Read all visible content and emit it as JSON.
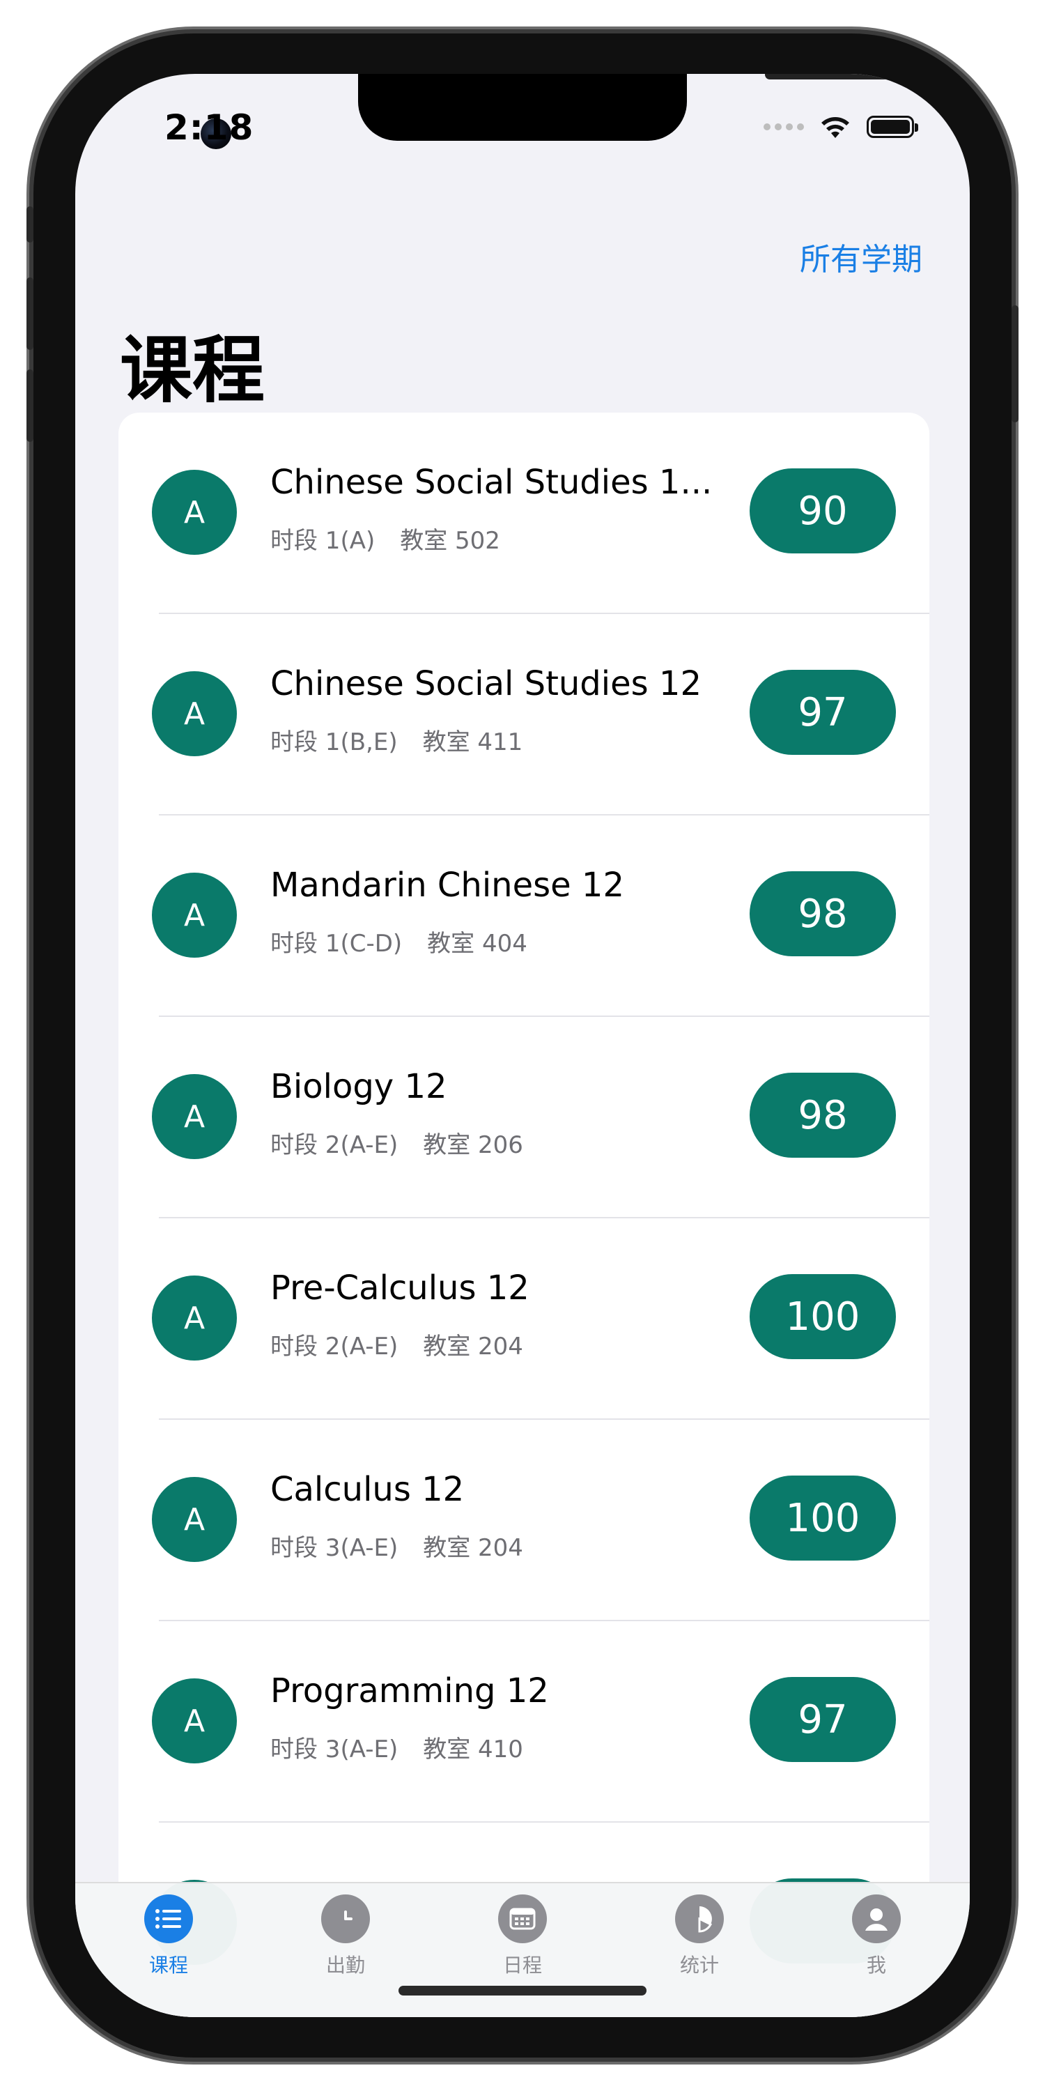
{
  "status_bar": {
    "time": "2:18"
  },
  "nav": {
    "right_link": "所有学期"
  },
  "page": {
    "title": "课程"
  },
  "courses": [
    {
      "avatar": "A",
      "name": "Chinese Social Studies 1...",
      "period": "时段 1(A)",
      "room": "教室 502",
      "grade": "90"
    },
    {
      "avatar": "A",
      "name": "Chinese Social Studies 12",
      "period": "时段 1(B,E)",
      "room": "教室 411",
      "grade": "97"
    },
    {
      "avatar": "A",
      "name": "Mandarin Chinese 12",
      "period": "时段 1(C-D)",
      "room": "教室 404",
      "grade": "98"
    },
    {
      "avatar": "A",
      "name": "Biology 12",
      "period": "时段 2(A-E)",
      "room": "教室 206",
      "grade": "98"
    },
    {
      "avatar": "A",
      "name": "Pre-Calculus 12",
      "period": "时段 2(A-E)",
      "room": "教室 204",
      "grade": "100"
    },
    {
      "avatar": "A",
      "name": "Calculus 12",
      "period": "时段 3(A-E)",
      "room": "教室 204",
      "grade": "100"
    },
    {
      "avatar": "A",
      "name": "Programming 12",
      "period": "时段 3(A-E)",
      "room": "教室 410",
      "grade": "97"
    }
  ],
  "tabbar": {
    "items": [
      {
        "label": "课程",
        "icon": "list-icon",
        "active": true
      },
      {
        "label": "出勤",
        "icon": "clock-icon",
        "active": false
      },
      {
        "label": "日程",
        "icon": "calendar-icon",
        "active": false
      },
      {
        "label": "统计",
        "icon": "pie-chart-icon",
        "active": false
      },
      {
        "label": "我",
        "icon": "person-icon",
        "active": false
      }
    ]
  },
  "colors": {
    "accent": "#1a7fe5",
    "course_green": "#0a7a6a",
    "background": "#f2f2f7"
  }
}
